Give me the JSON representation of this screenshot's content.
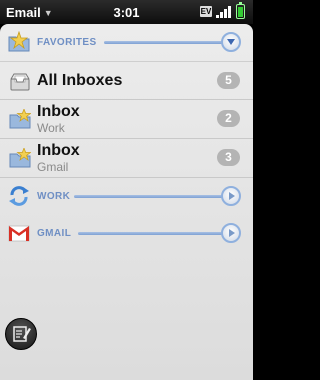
{
  "statusbar": {
    "app_name": "Email",
    "time": "3:01",
    "carrier_badge": "EV",
    "battery_level": 0.9
  },
  "favorites": {
    "label": "FAVORITES",
    "expanded": true
  },
  "mailboxes": [
    {
      "title": "All Inboxes",
      "subtitle": "",
      "count": "5"
    },
    {
      "title": "Inbox",
      "subtitle": "Work",
      "count": "2"
    },
    {
      "title": "Inbox",
      "subtitle": "Gmail",
      "count": "3"
    }
  ],
  "accounts": [
    {
      "label": "WORK",
      "icon": "sync-icon",
      "expanded": false
    },
    {
      "label": "GMAIL",
      "icon": "gmail-icon",
      "expanded": false
    }
  ],
  "compose": {
    "icon": "compose-icon"
  },
  "colors": {
    "divider_label": "#6f8fc4",
    "divider_line": "#7ea1d4",
    "count_badge": "#b4b4b4",
    "background": "#e6e6e6"
  }
}
